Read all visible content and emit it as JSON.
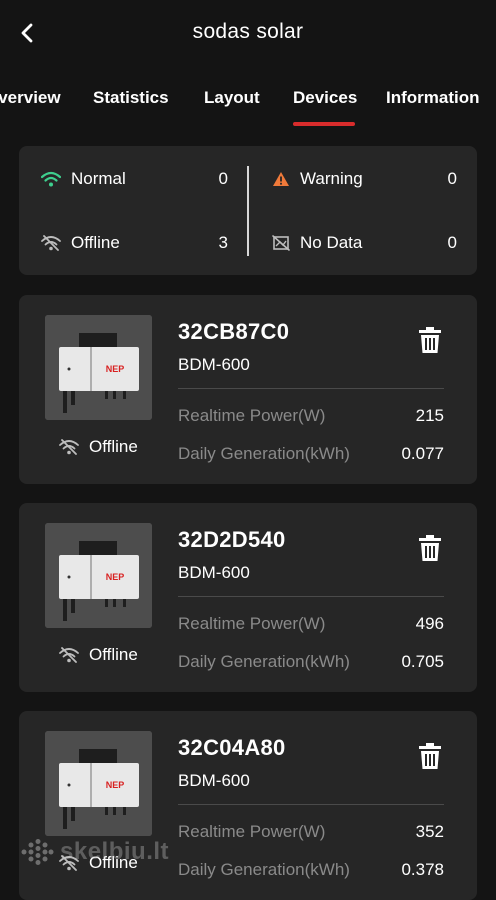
{
  "header": {
    "title": "sodas solar"
  },
  "tabs": [
    {
      "label": "Overview",
      "active": false
    },
    {
      "label": "Statistics",
      "active": false
    },
    {
      "label": "Layout",
      "active": false
    },
    {
      "label": "Devices",
      "active": true
    },
    {
      "label": "Information",
      "active": false
    }
  ],
  "summary": {
    "normal": {
      "label": "Normal",
      "count": "0",
      "color": "#3ecf8e"
    },
    "warning": {
      "label": "Warning",
      "count": "0",
      "color": "#f07a3a"
    },
    "offline": {
      "label": "Offline",
      "count": "3"
    },
    "nodata": {
      "label": "No Data",
      "count": "0"
    }
  },
  "devices": [
    {
      "id": "32CB87C0",
      "model": "BDM-600",
      "status": "Offline",
      "power_label": "Realtime Power(W)",
      "power": "215",
      "gen_label": "Daily Generation(kWh)",
      "gen": "0.077"
    },
    {
      "id": "32D2D540",
      "model": "BDM-600",
      "status": "Offline",
      "power_label": "Realtime Power(W)",
      "power": "496",
      "gen_label": "Daily Generation(kWh)",
      "gen": "0.705"
    },
    {
      "id": "32C04A80",
      "model": "BDM-600",
      "status": "Offline",
      "power_label": "Realtime Power(W)",
      "power": "352",
      "gen_label": "Daily Generation(kWh)",
      "gen": "0.378"
    }
  ],
  "watermark": {
    "text": "skelbiu.lt"
  },
  "colors": {
    "accent": "#d92c2c",
    "card": "#262626",
    "background": "#141414"
  }
}
